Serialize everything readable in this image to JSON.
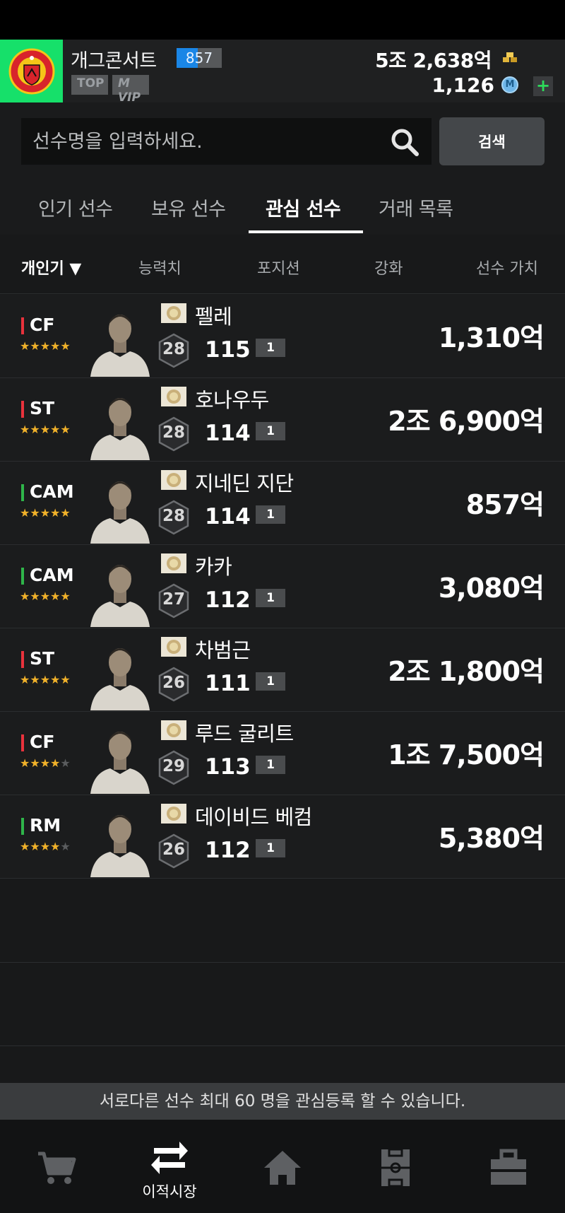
{
  "profile": {
    "nickname": "개그콘서트",
    "level": "857",
    "level_progress": 0.47,
    "badge_top": "TOP",
    "badge_vip": "M VIP",
    "bp_amount": "5조 2,638억",
    "mc_amount": "1,126",
    "mc_icon_letter": "M",
    "plus_symbol": "+"
  },
  "search": {
    "placeholder": "선수명을 입력하세요.",
    "button_label": "검색"
  },
  "tabs": [
    {
      "label": "인기 선수"
    },
    {
      "label": "보유 선수"
    },
    {
      "label": "관심 선수",
      "active": true
    },
    {
      "label": "거래 목록"
    }
  ],
  "columns": {
    "sort": "개인기 ▼",
    "ability": "능력치",
    "position": "포지션",
    "enhance": "강화",
    "value": "선수 가치"
  },
  "colors": {
    "forward": "#e8323c",
    "midfield": "#2fb54a",
    "star_on": "#f0b12a"
  },
  "players": [
    {
      "position": "CF",
      "group": "forward",
      "stars": 5,
      "name": "펠레",
      "ovr_badge": "28",
      "ovr": "115",
      "grade": "1",
      "price": "1,310억"
    },
    {
      "position": "ST",
      "group": "forward",
      "stars": 5,
      "name": "호나우두",
      "ovr_badge": "28",
      "ovr": "114",
      "grade": "1",
      "price": "2조 6,900억"
    },
    {
      "position": "CAM",
      "group": "midfield",
      "stars": 5,
      "name": "지네딘 지단",
      "ovr_badge": "28",
      "ovr": "114",
      "grade": "1",
      "price": "857억"
    },
    {
      "position": "CAM",
      "group": "midfield",
      "stars": 5,
      "name": "카카",
      "ovr_badge": "27",
      "ovr": "112",
      "grade": "1",
      "price": "3,080억"
    },
    {
      "position": "ST",
      "group": "forward",
      "stars": 5,
      "name": "차범근",
      "ovr_badge": "26",
      "ovr": "111",
      "grade": "1",
      "price": "2조 1,800억"
    },
    {
      "position": "CF",
      "group": "forward",
      "stars": 4,
      "name": "루드 굴리트",
      "ovr_badge": "29",
      "ovr": "113",
      "grade": "1",
      "price": "1조 7,500억"
    },
    {
      "position": "RM",
      "group": "midfield",
      "stars": 4,
      "name": "데이비드 베컴",
      "ovr_badge": "26",
      "ovr": "112",
      "grade": "1",
      "price": "5,380억"
    }
  ],
  "notice": "서로다른 선수 최대 60 명을 관심등록 할 수 있습니다.",
  "nav": [
    {
      "icon": "cart-icon",
      "label": ""
    },
    {
      "icon": "transfer-icon",
      "label": "이적시장",
      "active": true
    },
    {
      "icon": "home-icon",
      "label": ""
    },
    {
      "icon": "field-icon",
      "label": ""
    },
    {
      "icon": "briefcase-icon",
      "label": ""
    }
  ]
}
